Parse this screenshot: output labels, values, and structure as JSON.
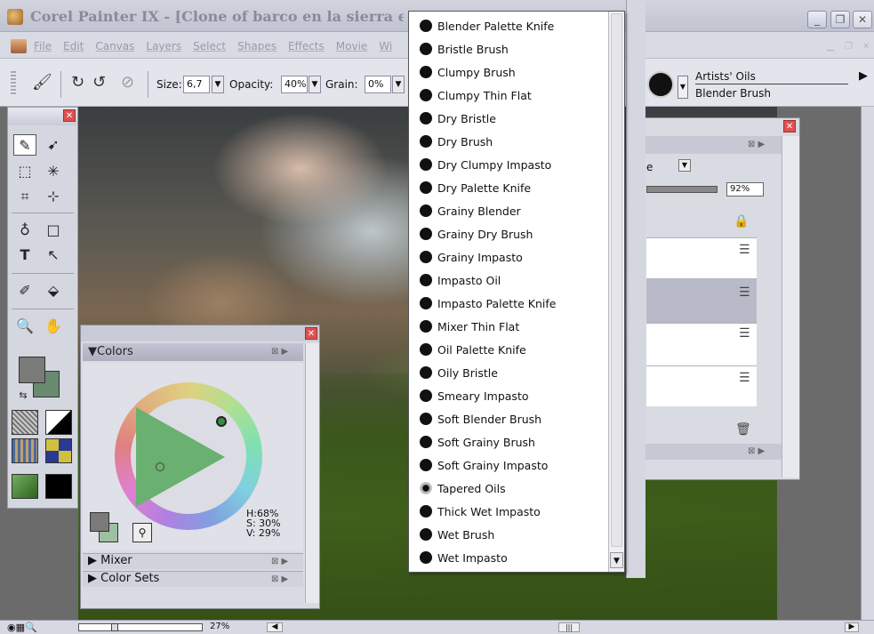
{
  "window": {
    "title": "Corel Painter IX - [Clone of barco en la sierra estelar.r",
    "minimize_glyph": "_",
    "restore_glyph": "❐",
    "close_glyph": "✕"
  },
  "menu": {
    "items": [
      "File",
      "Edit",
      "Canvas",
      "Layers",
      "Select",
      "Shapes",
      "Effects",
      "Movie",
      "Wi"
    ]
  },
  "property_bar": {
    "size_label": "Size:",
    "size_value": "6,7",
    "opacity_label": "Opacity:",
    "opacity_value": "40%",
    "grain_label": "Grain:",
    "grain_value": "0%",
    "brush_category": "Artists' Oils",
    "brush_variant": "Blender Brush"
  },
  "brush_variants": [
    "Blender Palette Knife",
    "Bristle Brush",
    "Clumpy Brush",
    "Clumpy Thin Flat",
    "Dry Bristle",
    "Dry Brush",
    "Dry Clumpy Impasto",
    "Dry Palette Knife",
    "Grainy Blender",
    "Grainy Dry Brush",
    "Grainy Impasto",
    "Impasto Oil",
    "Impasto Palette Knife",
    "Mixer Thin Flat",
    "Oil Palette Knife",
    "Oily Bristle",
    "Smeary Impasto",
    "Soft Blender Brush",
    "Soft Grainy Brush",
    "Soft Grainy Impasto",
    "Tapered Oils",
    "Thick Wet Impasto",
    "Wet Brush",
    "Wet Impasto"
  ],
  "colors_panel": {
    "title": "Colors",
    "h": "H:68%",
    "s": "S: 30%",
    "v": "V: 29%",
    "mixer_label": "Mixer",
    "color_sets_label": "Color Sets",
    "hue_fraction": 0.68,
    "saturation_fraction": 0.3,
    "value_fraction": 0.29
  },
  "layers_panel": {
    "composite_method_fragment": "e",
    "opacity_value": "92%",
    "opacity_fraction": 0.92
  },
  "status_bar": {
    "zoom": "27%",
    "zoom_fraction": 0.27
  },
  "colors": {
    "main_color": "#7a7a78",
    "additional_color": "#9cc0a2"
  },
  "icons": {
    "brush": "brush-icon",
    "layer_adjuster": "layer-adjuster-icon",
    "rect_select": "rect-select-icon",
    "magic_wand": "magic-wand-icon",
    "crop": "crop-icon",
    "pen": "pen-icon",
    "text": "text-icon",
    "dropper": "dropper-icon",
    "paint_bucket": "paint-bucket-icon",
    "magnifier": "magnifier-icon",
    "grabber": "grabber-icon"
  }
}
